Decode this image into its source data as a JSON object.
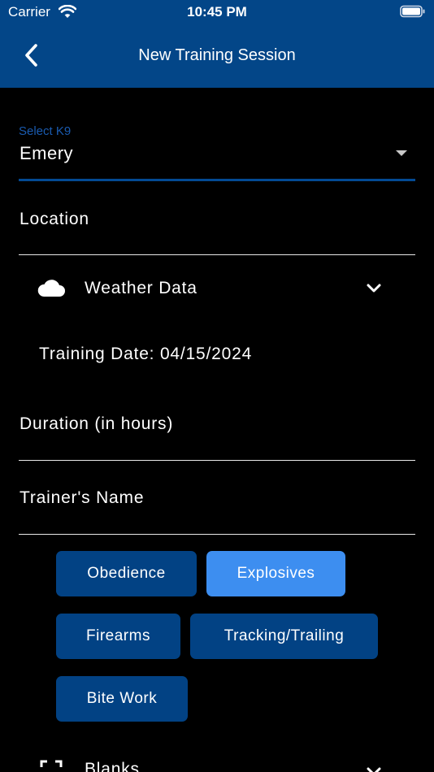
{
  "status_bar": {
    "carrier": "Carrier",
    "time": "10:45 PM"
  },
  "nav": {
    "title": "New Training Session",
    "back_icon": "chevron-left-icon"
  },
  "form": {
    "k9": {
      "label": "Select K9",
      "value": "Emery"
    },
    "location": {
      "placeholder": "Location"
    },
    "weather": {
      "label": "Weather Data",
      "icon": "cloud-icon"
    },
    "training_date": "Training Date: 04/15/2024",
    "duration": {
      "placeholder": "Duration (in hours)"
    },
    "trainer": {
      "placeholder": "Trainer's Name"
    },
    "categories": [
      {
        "label": "Obedience",
        "selected": false
      },
      {
        "label": "Explosives",
        "selected": true
      },
      {
        "label": "Firearms",
        "selected": false
      },
      {
        "label": "Tracking/Trailing",
        "selected": false
      },
      {
        "label": "Bite Work",
        "selected": false
      }
    ],
    "blanks": {
      "label": "Blanks"
    }
  },
  "colors": {
    "header": "#034688",
    "chip": "#024284",
    "chip_selected": "#3d8ef0",
    "accent": "#1a5bb0"
  }
}
